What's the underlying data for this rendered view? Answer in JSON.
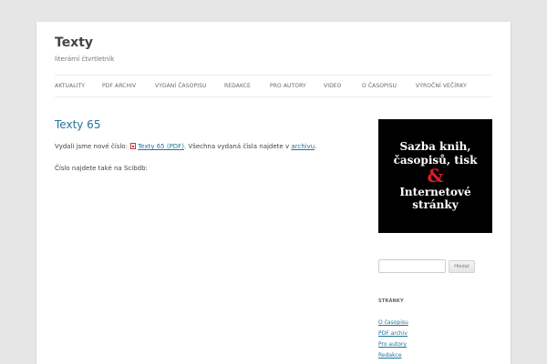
{
  "site": {
    "title": "Texty",
    "description": "literární čtvrtletník"
  },
  "nav": {
    "items": [
      {
        "label": "AKTUALITY"
      },
      {
        "label": "PDF ARCHIV"
      },
      {
        "label": "VYDÁNÍ ČASOPISU"
      },
      {
        "label": "REDAKCE"
      },
      {
        "label": "PRO AUTORY"
      },
      {
        "label": "VIDEO"
      },
      {
        "label": "O ČASOPISU"
      },
      {
        "label": "VÝROČNÍ VEČÍRKY"
      }
    ]
  },
  "post": {
    "title": "Texty 65",
    "p1_before": "Vydali jsme nové číslo: ",
    "p1_link": "Texty 65 (PDF)",
    "p1_middle": ". Všechna vydaná čísla najdete v ",
    "p1_link2": "archivu",
    "p1_after": ".",
    "p2": "Číslo najdete také na Scibdb:",
    "pdf_icon": "pdf-file-icon"
  },
  "ad": {
    "line1": "Sazba knih,",
    "line2": "časopisů, tisk",
    "amp": "&",
    "line3": "Internetové",
    "line4": "stránky",
    "accent": "#d91f2a"
  },
  "search": {
    "value": "",
    "button_label": "Hledat"
  },
  "widget": {
    "title": "STRÁNKY",
    "links": [
      {
        "label": "O časopisu"
      },
      {
        "label": "PDF archiv"
      },
      {
        "label": "Pro autory"
      },
      {
        "label": "Redakce"
      }
    ]
  },
  "colors": {
    "link": "#21759b",
    "background": "#e6e6e6"
  }
}
